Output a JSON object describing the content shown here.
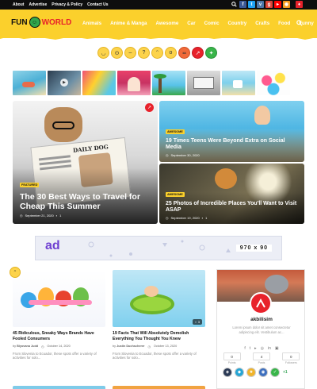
{
  "topbar": {
    "links": [
      "About",
      "Advertise",
      "Privacy & Policy",
      "Contact Us"
    ],
    "icons": [
      "search-icon",
      "facebook-icon",
      "twitter-icon",
      "vk-icon",
      "google-plus-icon",
      "youtube-icon",
      "rss-icon",
      "user-icon"
    ]
  },
  "logo": {
    "part1": "FUN",
    "part2": "WORLD"
  },
  "nav": {
    "items": [
      "Animals",
      "Anime & Manga",
      "Awesome",
      "Car",
      "Comic",
      "Country",
      "Crafts",
      "Food",
      "Funny"
    ],
    "search_icon": "search-icon"
  },
  "reactions": [
    {
      "icon": "smile-emoji"
    },
    {
      "icon": "glasses-emoji"
    },
    {
      "icon": "neutral-emoji"
    },
    {
      "icon": "thinking-emoji"
    },
    {
      "icon": "tongue-emoji"
    },
    {
      "icon": "shock-emoji"
    },
    {
      "icon": "angry-emoji"
    },
    {
      "icon": "trending-icon"
    },
    {
      "icon": "fresh-icon"
    }
  ],
  "featured": {
    "main": {
      "badge": "Featured",
      "title": "The 30 Best Ways to Travel for Cheap This Summer",
      "date": "September 21, 2020",
      "comments": "1"
    },
    "top_right": {
      "badge": "Awesome",
      "title": "19 Times Teens Were Beyond Extra on Social Media",
      "date": "September 30, 2020"
    },
    "bottom_right": {
      "badge": "Awesome",
      "title": "25 Photos of Incredible Places You'll Want to Visit ASAP",
      "date": "September 19, 2020",
      "comments": "1"
    }
  },
  "ad": {
    "letters": "ad",
    "size": "970 x 90"
  },
  "posts": [
    {
      "title": "45 Ridiculous, Sneaky Ways Brands Have Fooled Consumers",
      "author": "Biyovana Judd",
      "date": "October 14, 2020",
      "excerpt": "From Slovenia to Ecuador, these spots offer a variety of activities for solo..."
    },
    {
      "title": "19 Facts That Will Absolutely Demolish Everything You Thought You Knew",
      "author": "Justin Duchscherer",
      "date": "October 13, 2020",
      "excerpt": "From Slovenia to Ecuador, these spots offer a variety of activities for solo...",
      "comments": "3"
    }
  ],
  "profile": {
    "name": "akbilisim",
    "bio": "Lorem ipsum dolor sit amet consectetur adipiscing elit. Vestibulum ac...",
    "stats": [
      {
        "value": "0",
        "label": "Points"
      },
      {
        "value": "4",
        "label": "Posts"
      },
      {
        "value": "0",
        "label": "Followers"
      }
    ],
    "extra_badges": "+1"
  },
  "colors": {
    "accent": "#fbd02c",
    "red": "#e8222b",
    "dark": "#0e0e0e"
  }
}
